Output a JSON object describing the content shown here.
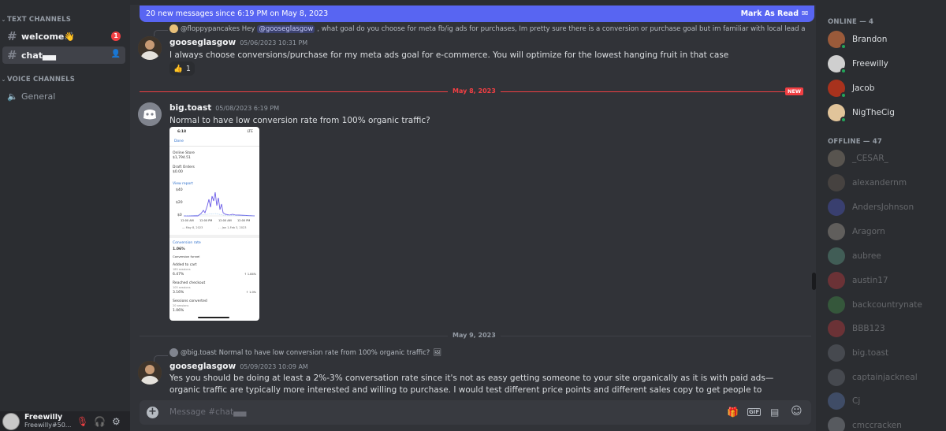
{
  "sidebar": {
    "text_channels_label": "TEXT CHANNELS",
    "voice_channels_label": "VOICE CHANNELS",
    "channels": [
      {
        "name": "welcome👋",
        "badge": "1"
      },
      {
        "name": "chat▄▄"
      }
    ],
    "voice_channels": [
      {
        "name": "General"
      }
    ],
    "user": {
      "name": "Freewilly",
      "tag": "Freewilly#50..."
    }
  },
  "chat": {
    "new_messages_banner": "20 new messages since 6:19 PM on May 8, 2023",
    "mark_as_read": "Mark As Read",
    "messages": [
      {
        "reply_author": "@floppypancakes",
        "reply_pre": "Hey",
        "reply_mention": "@gooseglasgow",
        "reply_text": ", what goal do you choose for meta fb/ig ads for purchases, Im pretty sure there is a conversion or purchase goal but im familiar with local lead a",
        "author": "gooseglasgow",
        "timestamp": "05/06/2023 10:31 PM",
        "text": "I always choose conversions/purchase for my meta ads goal for e-commerce. You will optimize for the lowest hanging fruit in that case",
        "reaction_emoji": "👍",
        "reaction_count": "1"
      },
      {
        "author": "big.toast",
        "timestamp": "05/08/2023 6:19 PM",
        "text": "Normal to have low conversion rate from 100% organic traffic?"
      },
      {
        "reply_author": "@big.toast",
        "reply_text": "Normal to have low conversion rate from 100% organic traffic?",
        "author": "gooseglasgow",
        "timestamp": "05/09/2023 10:09 AM",
        "text": "Yes you should be doing at least a 2%-3% conversation rate since it's not as easy getting someone to your site organically as it is with paid ads— organic traffic are typically more interested and willing to purchase. I would test different price points and different sales copy to get people to convert. Clearly they're not sold on"
      }
    ],
    "divider_1": "May 8, 2023",
    "new_tag": "NEW",
    "divider_2": "May 9, 2023",
    "input_placeholder": "Message #chat▄▄",
    "gif_label": "GIF",
    "attachment": {
      "status_time": "6:18",
      "status_right": "LTE",
      "done": "Done",
      "online_store_label": "Online Store",
      "online_store_value": "$1,794.51",
      "draft_orders_label": "Draft Orders",
      "draft_orders_value": "$0.00",
      "view_report": "View report",
      "y_ticks": [
        "$40",
        "$20",
        "$0"
      ],
      "x_ticks": [
        "12:00 AM",
        "12:00 PM",
        "12:00 AM",
        "12:00 PM"
      ],
      "legend_a": "— May 8, 2023",
      "legend_b": "- - Jan 1-Feb 3, 2023",
      "conversion_rate": "Conversion rate",
      "conversion_value": "1.06%",
      "conversion_funnel": "Conversion funnel",
      "added_to_cart": "Added to cart",
      "added_sub": "185 sessions",
      "added_value": "6.47%",
      "added_right": "↑ 1.84%",
      "reached_checkout": "Reached checkout",
      "reached_sub": "105 sessions",
      "reached_value": "3.16%",
      "reached_right": "↑ 1.0%",
      "sessions_converted": "Sessions converted",
      "sessions_sub": "20 sessions",
      "sessions_value": "1.06%"
    }
  },
  "members": {
    "online_label": "ONLINE — 4",
    "offline_label": "OFFLINE — 47",
    "online": [
      "Brandon",
      "Freewilly",
      "Jacob",
      "NigTheCig"
    ],
    "offline": [
      "_CESAR_",
      "alexandernm",
      "AndersJohnson",
      "Aragorn",
      "aubree",
      "austin17",
      "backcountrynate",
      "BBB123",
      "big.toast",
      "captainjackneal",
      "Cj",
      "cmccracken"
    ]
  },
  "colors": {
    "blurple": "#5865f2",
    "red": "#f23f43",
    "green": "#23a55a"
  },
  "icons": [
    "hash-icon",
    "speaker-icon",
    "add-member-icon",
    "mic-muted-icon",
    "headphones-icon",
    "gear-icon",
    "plus-icon",
    "gift-icon",
    "sticker-icon",
    "emoji-icon",
    "mark-read-icon",
    "image-icon"
  ]
}
